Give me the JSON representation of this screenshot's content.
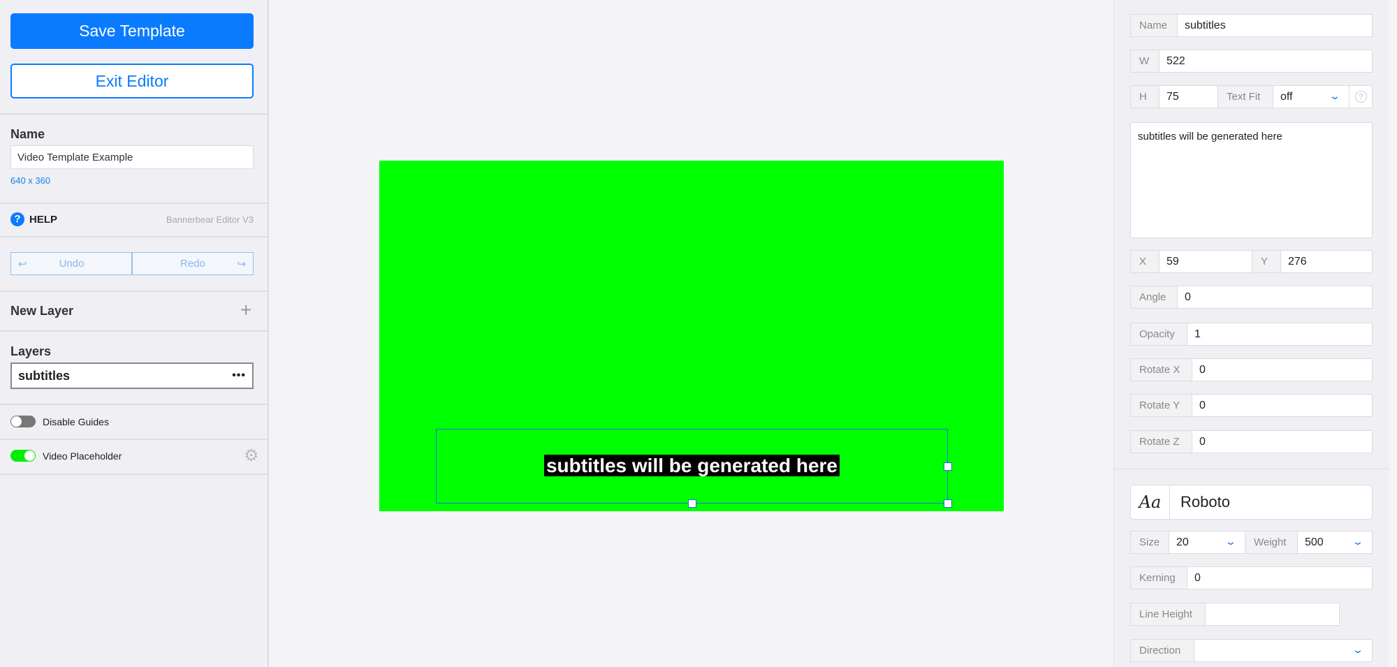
{
  "left": {
    "save_label": "Save Template",
    "exit_label": "Exit Editor",
    "name_label": "Name",
    "name_value": "Video Template Example",
    "dimensions": "640 x 360",
    "help_label": "HELP",
    "editor_version": "Bannerbear Editor V3",
    "undo_label": "Undo",
    "redo_label": "Redo",
    "new_layer_label": "New Layer",
    "layers_label": "Layers",
    "layers": [
      {
        "name": "subtitles",
        "selected": true
      }
    ],
    "disable_guides_label": "Disable Guides",
    "disable_guides_on": false,
    "video_placeholder_label": "Video Placeholder",
    "video_placeholder_on": true
  },
  "canvas": {
    "background": "#00ff00",
    "subtitle_text": "subtitles will be generated here"
  },
  "right": {
    "name_label": "Name",
    "name_value": "subtitles",
    "w_label": "W",
    "w_value": "522",
    "h_label": "H",
    "h_value": "75",
    "textfit_label": "Text Fit",
    "textfit_value": "off",
    "text_value": "subtitles will be generated here",
    "x_label": "X",
    "x_value": "59",
    "y_label": "Y",
    "y_value": "276",
    "angle_label": "Angle",
    "angle_value": "0",
    "opacity_label": "Opacity",
    "opacity_value": "1",
    "rotx_label": "Rotate X",
    "rotx_value": "0",
    "roty_label": "Rotate Y",
    "roty_value": "0",
    "rotz_label": "Rotate Z",
    "rotz_value": "0",
    "font_icon": "Aa",
    "font_value": "Roboto",
    "size_label": "Size",
    "size_value": "20",
    "weight_label": "Weight",
    "weight_value": "500",
    "kerning_label": "Kerning",
    "kerning_value": "0",
    "lineheight_label": "Line Height",
    "lineheight_value": "",
    "direction_label": "Direction",
    "direction_value": ""
  },
  "colors": {
    "accent": "#0a7bff",
    "toggle_on": "#00ee00"
  }
}
